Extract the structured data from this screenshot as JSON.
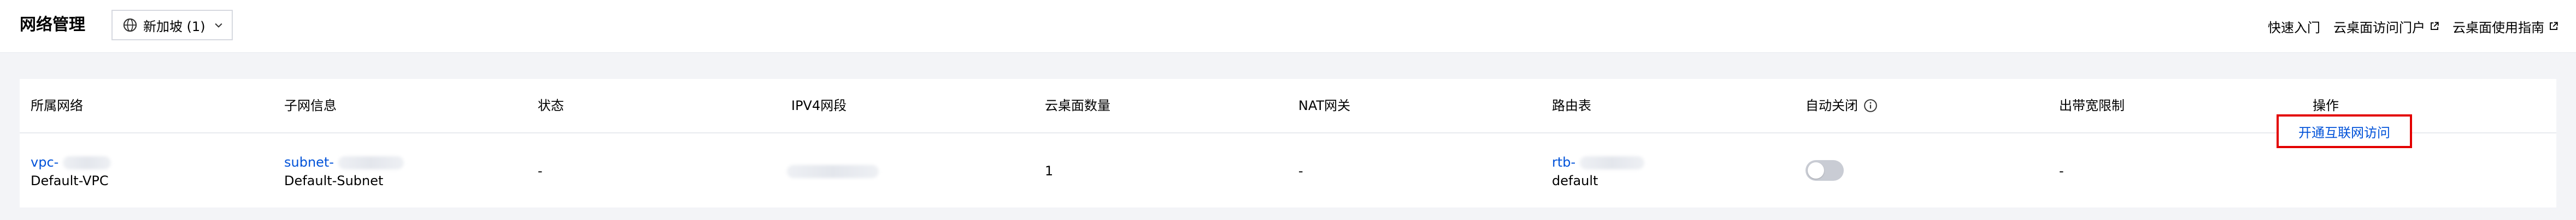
{
  "header": {
    "title": "网络管理",
    "region_select": {
      "value": "新加坡 (1)",
      "icon": "globe-icon",
      "chevron": "chevron-down-icon"
    },
    "quick_links": [
      {
        "label": "快速入门",
        "external": false
      },
      {
        "label": "云桌面访问门户",
        "external": true,
        "icon": "external-link-icon"
      },
      {
        "label": "云桌面使用指南",
        "external": true,
        "icon": "external-link-icon"
      }
    ]
  },
  "table": {
    "columns": [
      "所属网络",
      "子网信息",
      "状态",
      "IPV4网段",
      "云桌面数量",
      "NAT网关",
      "路由表",
      "自动关闭",
      "出带宽限制",
      "操作"
    ],
    "auto_close_info_icon": "info-icon",
    "rows": [
      {
        "network_id": "vpc-",
        "network_name": "Default-VPC",
        "subnet_id": "subnet-",
        "subnet_name": "Default-Subnet",
        "status": "-",
        "desktop_count": "1",
        "nat_gateway": "-",
        "route_table_id": "rtb-",
        "route_table_name": "default",
        "auto_close_enabled": false,
        "bandwidth_limit": "-",
        "action_label": "开通互联网访问"
      }
    ]
  },
  "colors": {
    "link": "#0052d9",
    "highlight_border": "#e30000",
    "toggle_off": "#c9ccd4",
    "page_bg": "#f3f4f7"
  }
}
